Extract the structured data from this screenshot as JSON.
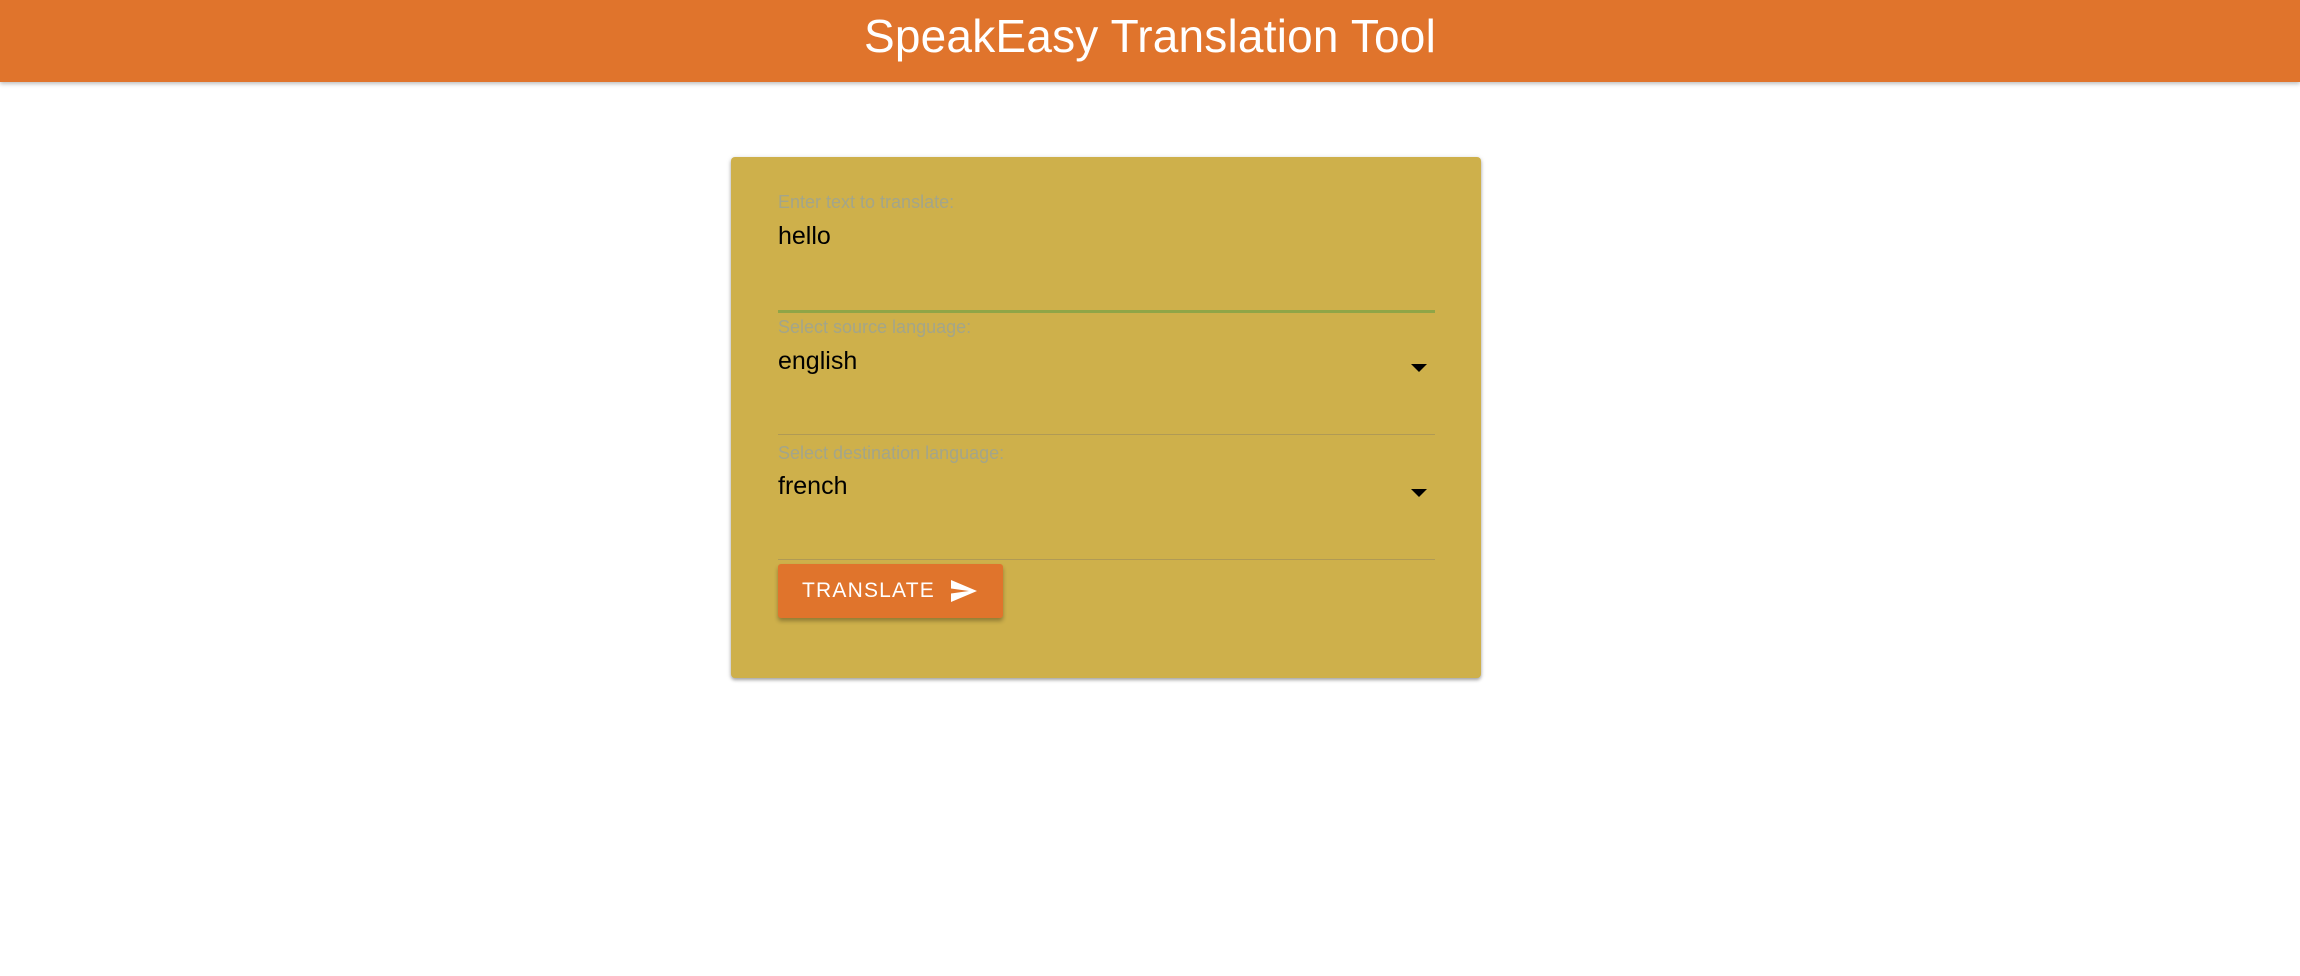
{
  "header": {
    "title": "SpeakEasy Translation Tool"
  },
  "form": {
    "text_input": {
      "label": "Enter text to translate:",
      "value": "hello"
    },
    "source_language": {
      "label": "Select source language:",
      "selected": "english"
    },
    "destination_language": {
      "label": "Select destination language:",
      "selected": "french"
    },
    "translate_button": {
      "label": "TRANSLATE",
      "icon": "send-icon"
    }
  },
  "colors": {
    "header_background": "#e0742c",
    "card_background": "#ceb04b",
    "button_background": "#e0742c",
    "focus_underline": "#8fa547"
  }
}
